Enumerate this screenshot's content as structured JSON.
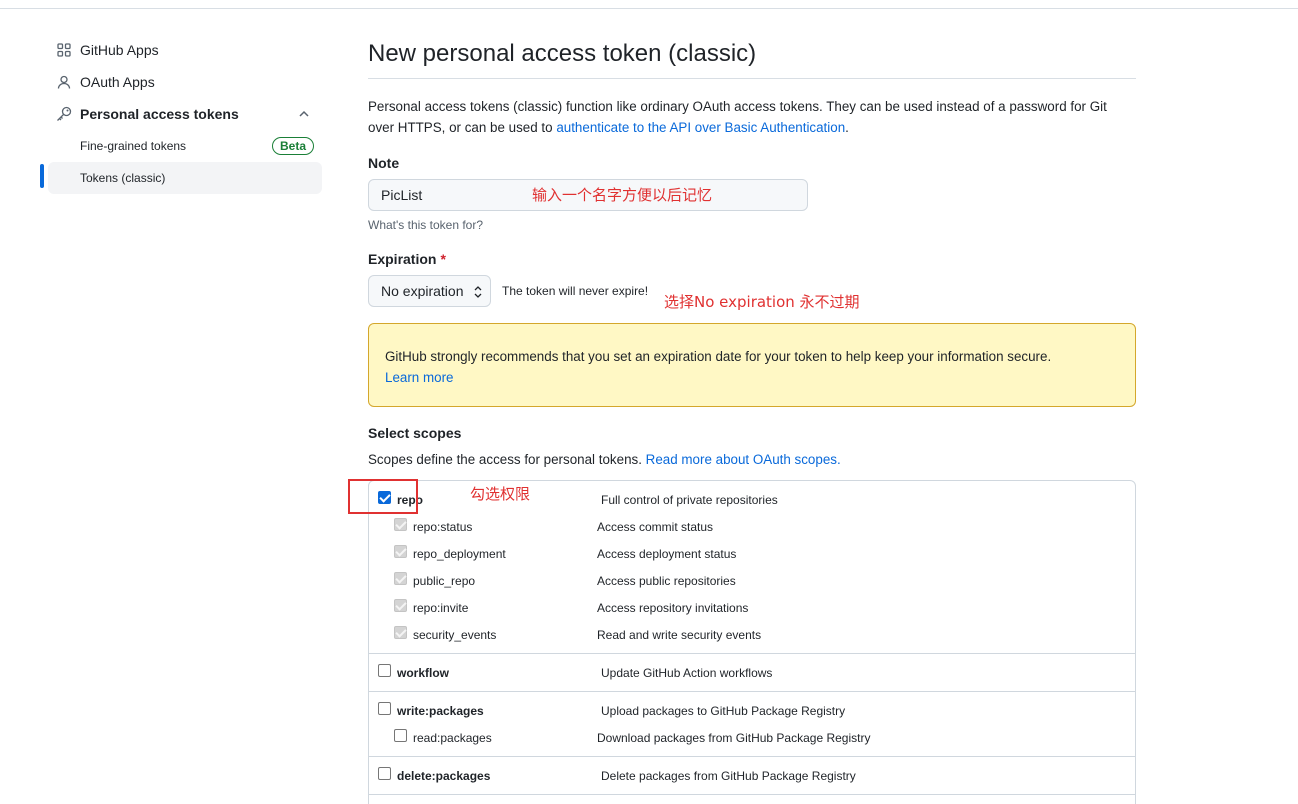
{
  "sidebar": {
    "items": [
      {
        "label": "GitHub Apps",
        "icon": "apps-icon"
      },
      {
        "label": "OAuth Apps",
        "icon": "person-icon"
      },
      {
        "label": "Personal access tokens",
        "icon": "key-icon"
      }
    ],
    "subitems": [
      {
        "label": "Fine-grained tokens",
        "badge": "Beta"
      },
      {
        "label": "Tokens (classic)",
        "active": true
      }
    ]
  },
  "main": {
    "title": "New personal access token (classic)",
    "intro_text": "Personal access tokens (classic) function like ordinary OAuth access tokens. They can be used instead of a password for Git over HTTPS, or can be used to ",
    "intro_link": "authenticate to the API over Basic Authentication",
    "intro_end": ".",
    "note": {
      "label": "Note",
      "value": "PicList",
      "hint": "What's this token for?"
    },
    "expiration": {
      "label": "Expiration",
      "required_mark": "*",
      "selected": "No expiration",
      "info": "The token will never expire!"
    },
    "warning": {
      "text": "GitHub strongly recommends that you set an expiration date for your token to help keep your information secure.",
      "link": "Learn more"
    },
    "scopes": {
      "label": "Select scopes",
      "desc": "Scopes define the access for personal tokens. ",
      "desc_link": "Read more about OAuth scopes.",
      "rows": [
        {
          "name": "repo",
          "desc": "Full control of private repositories",
          "checked": true,
          "level": 0
        },
        {
          "name": "repo:status",
          "desc": "Access commit status",
          "checked": true,
          "disabled": true,
          "level": 1
        },
        {
          "name": "repo_deployment",
          "desc": "Access deployment status",
          "checked": true,
          "disabled": true,
          "level": 1
        },
        {
          "name": "public_repo",
          "desc": "Access public repositories",
          "checked": true,
          "disabled": true,
          "level": 1
        },
        {
          "name": "repo:invite",
          "desc": "Access repository invitations",
          "checked": true,
          "disabled": true,
          "level": 1
        },
        {
          "name": "security_events",
          "desc": "Read and write security events",
          "checked": true,
          "disabled": true,
          "level": 1
        },
        {
          "name": "workflow",
          "desc": "Update GitHub Action workflows",
          "checked": false,
          "level": 0
        },
        {
          "name": "write:packages",
          "desc": "Upload packages to GitHub Package Registry",
          "checked": false,
          "level": 0
        },
        {
          "name": "read:packages",
          "desc": "Download packages from GitHub Package Registry",
          "checked": false,
          "level": 1
        },
        {
          "name": "delete:packages",
          "desc": "Delete packages from GitHub Package Registry",
          "checked": false,
          "level": 0
        }
      ]
    }
  },
  "annotations": {
    "note_tip": "输入一个名字方便以后记忆",
    "expiration_tip": "选择No expiration 永不过期",
    "scope_tip": "勾选权限"
  },
  "colors": {
    "accent": "#0969da",
    "annotation": "#e03131",
    "warning_bg": "#fff8c5",
    "beta": "#1a7f37"
  }
}
